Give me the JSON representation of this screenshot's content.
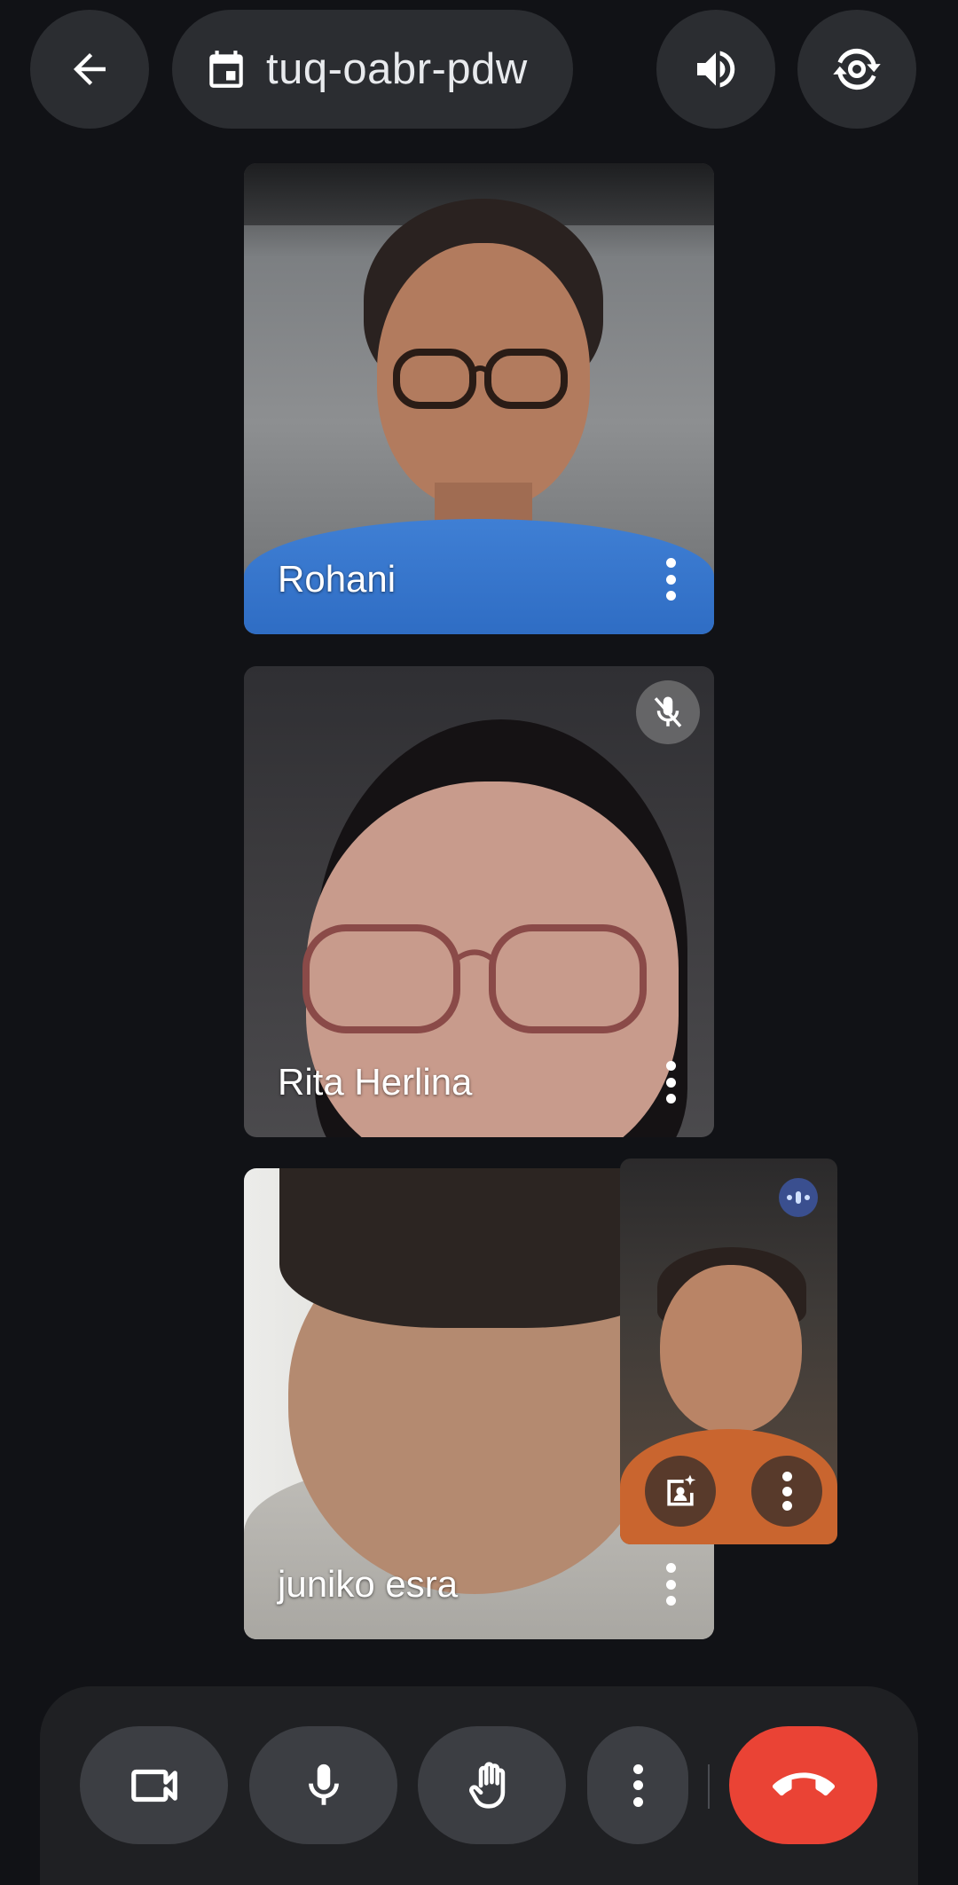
{
  "header": {
    "meeting_code": "tuq-oabr-pdw"
  },
  "participants": [
    {
      "name": "Rohani",
      "muted": false
    },
    {
      "name": "Rita Herlina",
      "muted": true
    },
    {
      "name": "juniko esra",
      "muted": false
    }
  ],
  "self_view": {
    "speaking": true
  },
  "colors": {
    "background": "#111216",
    "button": "#2b2d31",
    "control_button": "#3c3e43",
    "end_call": "#ea4335"
  },
  "icons": {
    "back": "arrow-left",
    "calendar": "calendar",
    "audio": "speaker",
    "switch_camera": "camera-flip",
    "camera": "video-camera",
    "mic": "microphone",
    "hand": "raise-hand",
    "more": "vertical-dots",
    "end": "phone-hangup",
    "effects": "portrait-sparkle"
  }
}
